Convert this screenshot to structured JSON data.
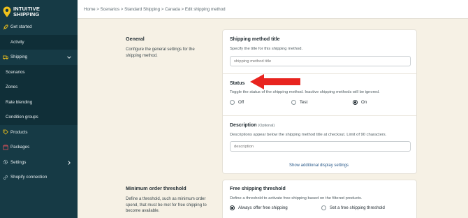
{
  "brand": {
    "line1": "INTUITIVE",
    "line2": "SHIPPING",
    "accent": "#f0c21b"
  },
  "sidebar": {
    "items": [
      {
        "label": "Get started",
        "icon": "rocket-icon"
      },
      {
        "label": "Activity",
        "icon": null
      },
      {
        "label": "Shipping",
        "icon": "truck-icon",
        "expanded": true
      },
      {
        "label": "Scenarios",
        "sub": true
      },
      {
        "label": "Zones",
        "sub": true
      },
      {
        "label": "Rate blending",
        "sub": true
      },
      {
        "label": "Condition groups",
        "sub": true
      },
      {
        "label": "Products",
        "icon": "tag-icon"
      },
      {
        "label": "Packages",
        "icon": "package-icon"
      },
      {
        "label": "Settings",
        "icon": "gear-icon"
      },
      {
        "label": "Shopify connection",
        "icon": "link-icon"
      }
    ]
  },
  "breadcrumb": "Home > Scenarios > Standard Shipping > Canada > Edit shipping method",
  "general": {
    "title": "General",
    "description": "Configure the general settings for the shipping method."
  },
  "method_title": {
    "label": "Shipping method title",
    "help": "Specify the title for this shipping method.",
    "placeholder": "shipping method title"
  },
  "status": {
    "label": "Status",
    "help": "Toggle the status of the shipping method. Inactive shipping methods will be ignored.",
    "options": [
      "Off",
      "Test",
      "On"
    ],
    "selected": "On"
  },
  "description_field": {
    "label": "Description",
    "optional": "(Optional)",
    "help": "Descriptions appear below the shipping method title at checkout. Limit of 90 characters.",
    "placeholder": "description"
  },
  "additional_link": "Show additional display settings",
  "minimum_order": {
    "title": "Minimum order threshold",
    "description": "Define a threshold, such as minimum order spend, that must be met for free shipping to become available."
  },
  "free_shipping": {
    "label": "Free shipping threshold",
    "help": "Define a threshold to activate free shipping based on the filtered products.",
    "options": [
      "Always offer free shipping",
      "Set a free shipping threshold"
    ],
    "selected": "Always offer free shipping"
  },
  "colors": {
    "sidebar": "#163a45",
    "background": "#f6f1e5",
    "arrow": "#e8241f"
  }
}
